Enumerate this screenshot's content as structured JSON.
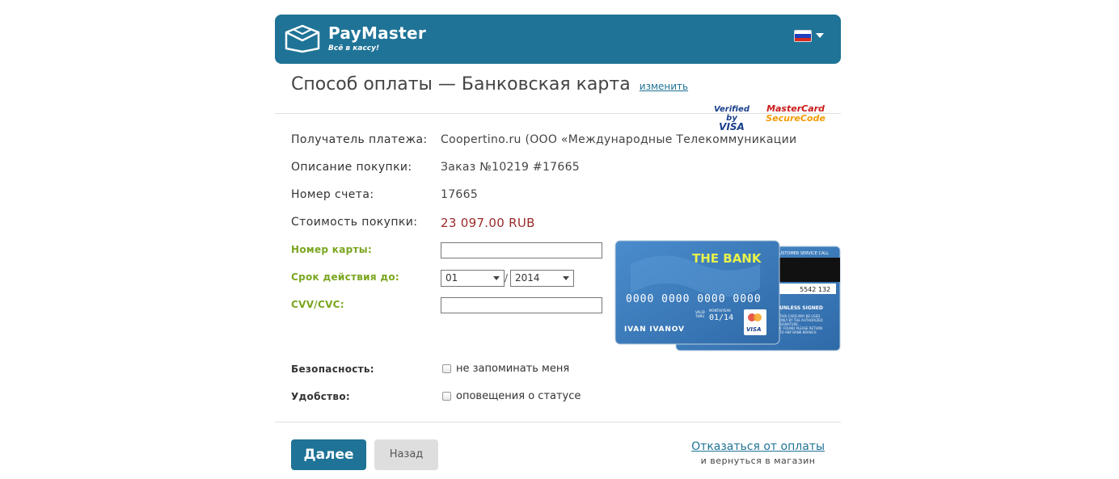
{
  "header": {
    "brand": "PayMaster",
    "slogan": "Всё в кассу!",
    "language_icon": "flag-ru-icon"
  },
  "page": {
    "title": "Способ оплаты — Банковская карта",
    "change_link": "изменить"
  },
  "security_logos": {
    "verified_by_visa": {
      "line1": "Verified by",
      "line2": "VISA"
    },
    "mastercard_securecode": {
      "line1": "MasterCard",
      "line2": "SecureCode"
    }
  },
  "details": [
    {
      "label": "Получатель платежа:",
      "value": "Coopertino.ru (ООО «Международные Телекоммуникации"
    },
    {
      "label": "Описание покупки:",
      "value": "Заказ №10219 #17665"
    },
    {
      "label": "Номер счета:",
      "value": "17665"
    },
    {
      "label": "Стоимость покупки:",
      "value": "23 097.00 RUB"
    }
  ],
  "form": {
    "card_number_label": "Номер карты:",
    "card_number_value": "",
    "expiry_label": "Срок действия до:",
    "expiry_month": "01",
    "expiry_separator": "/",
    "expiry_year": "2014",
    "cvv_label": "CVV/CVC:",
    "cvv_value": ""
  },
  "card_image": {
    "bank": "THE BANK",
    "number": "0000 0000 0000 0000",
    "valid_thru_label1": "VALID",
    "valid_thru_label2": "THRU",
    "month_year_label": "MONTH/YEAR",
    "expiry": "01/14",
    "holder": "IVAN IVANOV",
    "brand": "VISA",
    "back_header": "CUSTOMER SERVICE CALL",
    "back_code": "5542 132",
    "back_unless": "UNLESS SIGNED",
    "back_text": [
      "THIS CARD MAY BE USED",
      "ONLY BY THE AUTHORIZED",
      "SIGNATURE...",
      "IF FOUND PLEASE RETURN",
      "TO ANY BANK BRANCH"
    ]
  },
  "options": {
    "security_label": "Безопасность:",
    "security_checkbox_label": "не запоминать меня",
    "security_checked": false,
    "convenience_label": "Удобство:",
    "convenience_checkbox_label": "оповещения о статусе",
    "convenience_checked": false
  },
  "actions": {
    "next": "Далее",
    "back": "Назад",
    "cancel": "Отказаться от оплаты",
    "cancel_sub": "и вернуться в магазин"
  },
  "colors": {
    "brand_blue": "#1f7396",
    "field_label_green": "#7aa61f",
    "amount_red": "#9b2a2a",
    "card_blue": "#3a7dbd",
    "card_yellow_text": "#e8f24a"
  }
}
